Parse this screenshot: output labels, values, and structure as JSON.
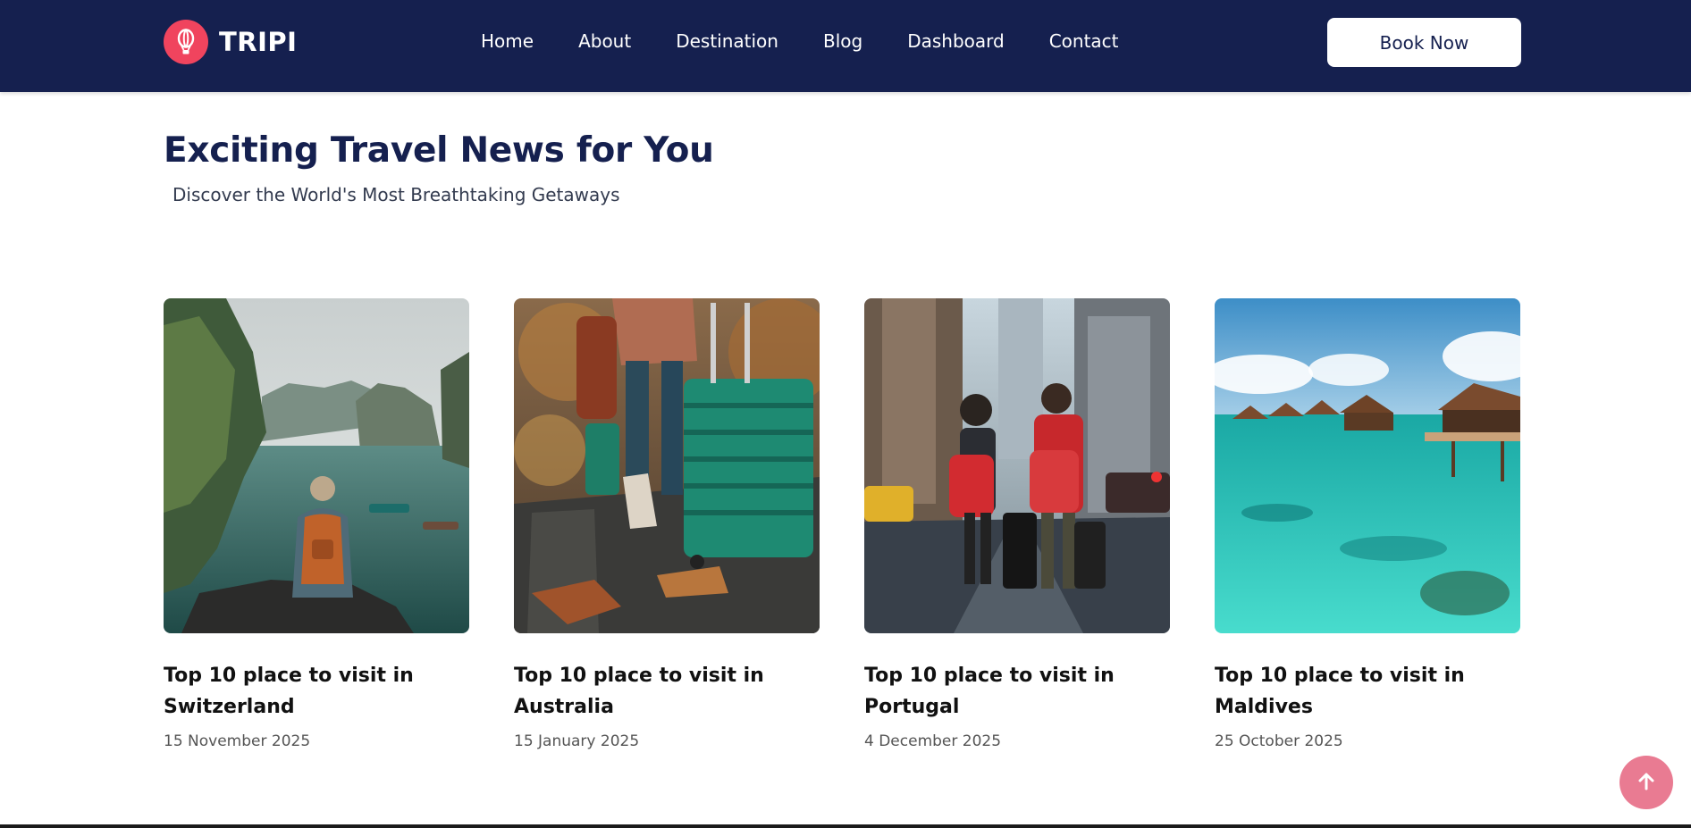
{
  "header": {
    "brand": "TRIPI",
    "logo_icon": "hot-air-balloon-icon",
    "nav": [
      "Home",
      "About",
      "Destination",
      "Blog",
      "Dashboard",
      "Contact"
    ],
    "cta_label": "Book Now"
  },
  "section": {
    "title": "Exciting Travel News for You",
    "subtitle": "Discover the World's Most Breathtaking Getaways"
  },
  "cards": [
    {
      "title": "Top 10 place to visit in Switzerland",
      "date": "15 November 2025",
      "image": "traveler-at-lake-photo"
    },
    {
      "title": "Top 10 place to visit in Australia",
      "date": "15 January 2025",
      "image": "traveler-with-suitcase-photo"
    },
    {
      "title": "Top 10 place to visit in Portugal",
      "date": "4 December 2025",
      "image": "kids-with-luggage-city-photo"
    },
    {
      "title": "Top 10 place to visit in Maldives",
      "date": "25 October 2025",
      "image": "overwater-bungalows-photo"
    }
  ],
  "scroll_top_icon": "arrow-up-icon",
  "colors": {
    "navy": "#15204f",
    "accent": "#f0445e",
    "scroll_button": "#e97b92"
  }
}
